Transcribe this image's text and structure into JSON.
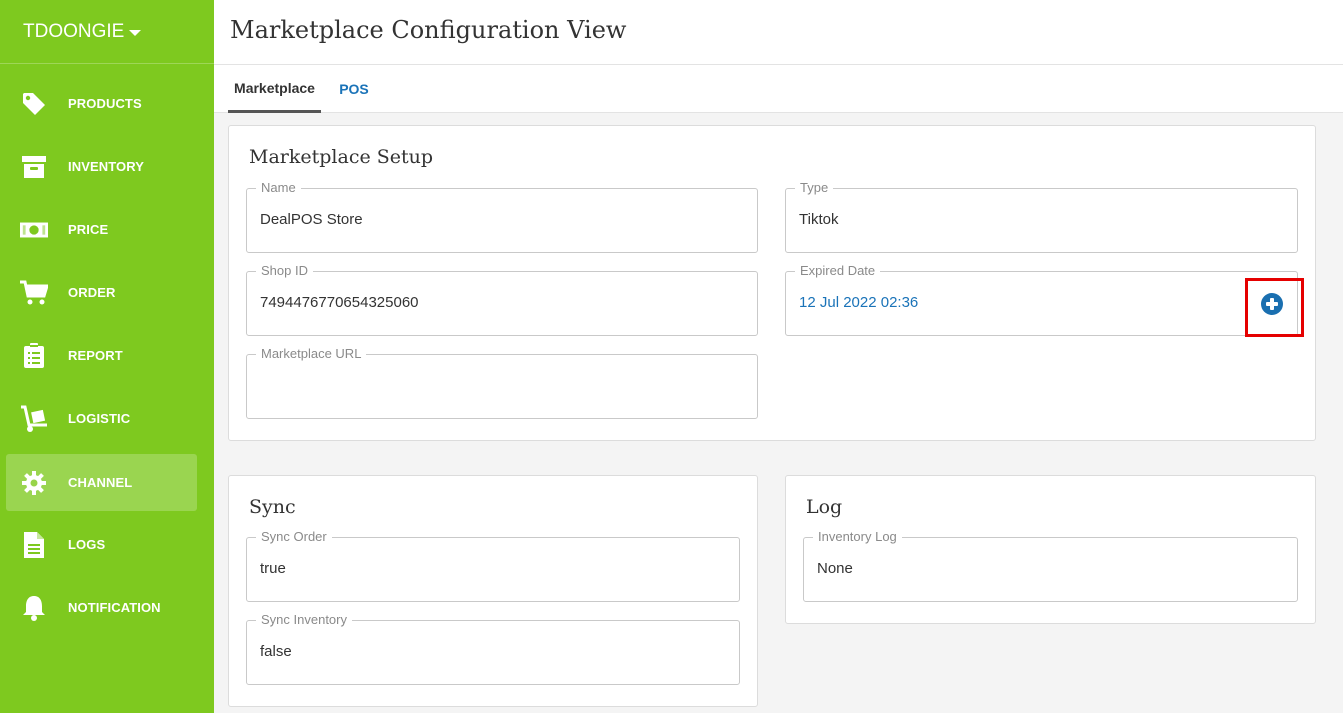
{
  "sidebar": {
    "brand": "TDOONGIE",
    "accent_color": "#7ec91f",
    "items": [
      {
        "label": "PRODUCTS",
        "icon": "tag-icon"
      },
      {
        "label": "INVENTORY",
        "icon": "archive-box-icon"
      },
      {
        "label": "PRICE",
        "icon": "money-bill-icon"
      },
      {
        "label": "ORDER",
        "icon": "shopping-cart-icon"
      },
      {
        "label": "REPORT",
        "icon": "clipboard-list-icon"
      },
      {
        "label": "LOGISTIC",
        "icon": "hand-truck-icon"
      },
      {
        "label": "CHANNEL",
        "icon": "gear-icon",
        "active": true
      },
      {
        "label": "LOGS",
        "icon": "document-icon"
      },
      {
        "label": "NOTIFICATION",
        "icon": "bell-icon"
      }
    ]
  },
  "header": {
    "title": "Marketplace Configuration View"
  },
  "tabs": [
    {
      "label": "Marketplace",
      "active": true
    },
    {
      "label": "POS",
      "active": false
    }
  ],
  "setup": {
    "title": "Marketplace Setup",
    "name": {
      "label": "Name",
      "value": "DealPOS Store"
    },
    "type": {
      "label": "Type",
      "value": "Tiktok"
    },
    "shop_id": {
      "label": "Shop ID",
      "value": "7494476770654325060"
    },
    "expired_date": {
      "label": "Expired Date",
      "value": "12 Jul 2022 02:36",
      "action_icon": "plus-circle-icon"
    },
    "marketplace_url": {
      "label": "Marketplace URL",
      "value": ""
    }
  },
  "sync": {
    "title": "Sync",
    "sync_order": {
      "label": "Sync Order",
      "value": "true"
    },
    "sync_inventory": {
      "label": "Sync Inventory",
      "value": "false"
    }
  },
  "log": {
    "title": "Log",
    "inventory_log": {
      "label": "Inventory Log",
      "value": "None"
    }
  }
}
